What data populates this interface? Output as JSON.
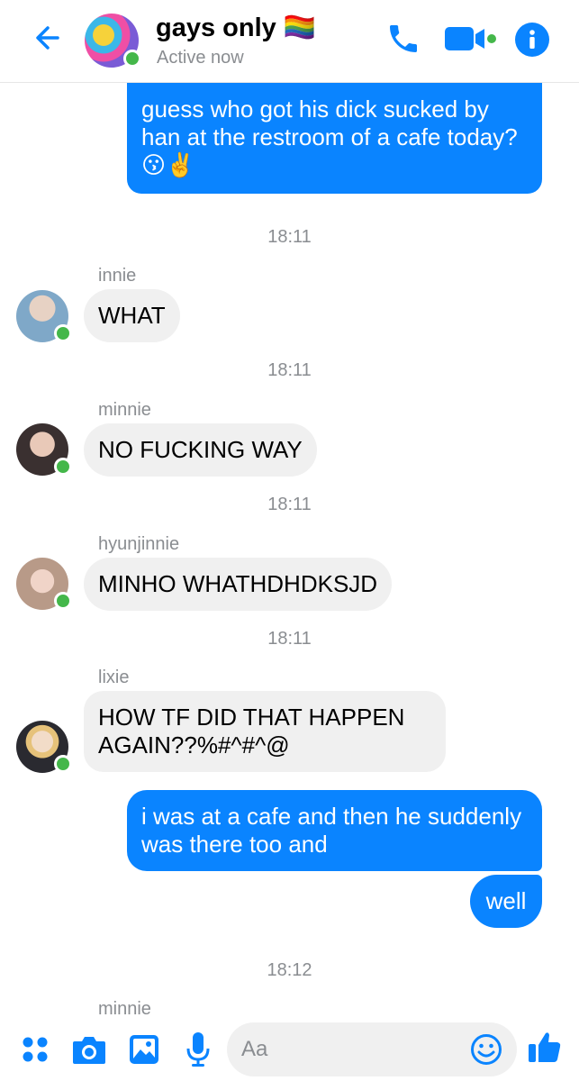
{
  "header": {
    "title": "gays only 🏳️‍🌈",
    "status": "Active now",
    "accent_color": "#0a84ff",
    "icons": [
      "back-arrow-icon",
      "phone-icon",
      "video-camera-icon",
      "info-icon"
    ]
  },
  "messages": [
    {
      "type": "out",
      "text": "guess who got his dick sucked by han at the restroom of a cafe today? 😗✌️"
    },
    {
      "type": "time",
      "text": "18:11"
    },
    {
      "type": "in",
      "sender": "innie",
      "text": "WHAT"
    },
    {
      "type": "time",
      "text": "18:11"
    },
    {
      "type": "in",
      "sender": "minnie",
      "text": "NO FUCKING WAY"
    },
    {
      "type": "time",
      "text": "18:11"
    },
    {
      "type": "in",
      "sender": "hyunjinnie",
      "text": "MINHO WHATHDHDKSJD"
    },
    {
      "type": "time",
      "text": "18:11"
    },
    {
      "type": "in",
      "sender": "lixie",
      "text": "HOW TF DID THAT HAPPEN AGAIN??%#^#^@"
    },
    {
      "type": "out",
      "text": "i was at a cafe and then he suddenly was there too and"
    },
    {
      "type": "out",
      "text": "well"
    },
    {
      "type": "time",
      "text": "18:12"
    },
    {
      "type": "sender-only",
      "sender": "minnie"
    }
  ],
  "composer": {
    "placeholder": "Aa",
    "icons": [
      "apps-icon",
      "camera-icon",
      "image-icon",
      "microphone-icon",
      "emoji-icon",
      "thumbs-up-icon"
    ]
  }
}
